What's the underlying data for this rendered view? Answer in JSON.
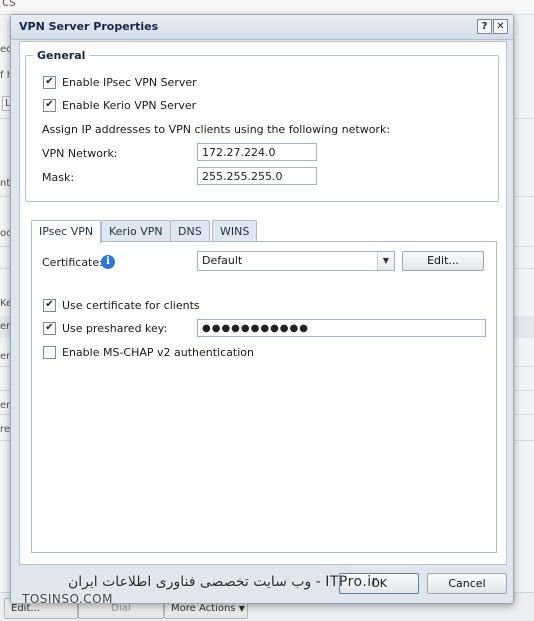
{
  "background": {
    "title_fragment": "cs",
    "fragments": [
      "ecti",
      "f h",
      "Lin",
      "nte",
      "oca",
      "Ke",
      "er",
      "erfa",
      "erfa",
      "re"
    ],
    "buttons": {
      "edit": "Edit...",
      "dial": "Dial",
      "more_actions": "More Actions"
    },
    "watermark_fa": "وب سایت تخصصی فناوری اطلاعات ایران - ITPro.ir",
    "watermark_en": "TOSINSO.COM"
  },
  "dialog": {
    "title": "VPN Server Properties",
    "help_glyph": "?",
    "close_glyph": "✕",
    "general": {
      "legend": "General",
      "enable_ipsec": {
        "label": "Enable IPsec VPN Server",
        "checked": true
      },
      "enable_kerio": {
        "label": "Enable Kerio VPN Server",
        "checked": true
      },
      "assign_text": "Assign IP addresses to VPN clients using the following network:",
      "network_label": "VPN Network:",
      "network_value": "172.27.224.0",
      "mask_label": "Mask:",
      "mask_value": "255.255.255.0"
    },
    "tabs": [
      "IPsec VPN",
      "Kerio VPN",
      "DNS",
      "WINS"
    ],
    "active_tab": "IPsec VPN",
    "ipsec": {
      "certificate_label": "Certificate:",
      "certificate_value": "Default",
      "edit_button": "Edit...",
      "use_cert": {
        "label": "Use certificate for clients",
        "checked": true
      },
      "use_psk": {
        "label": "Use preshared key:",
        "checked": true
      },
      "psk_value": "●●●●●●●●●●●",
      "mschap": {
        "label": "Enable MS-CHAP v2 authentication",
        "checked": false
      }
    },
    "buttons": {
      "ok": "OK",
      "cancel": "Cancel"
    }
  },
  "colors": {
    "title_text": "#15284b",
    "info_icon": "#2b78d0",
    "dialog_bg": "#dfe6ee"
  }
}
